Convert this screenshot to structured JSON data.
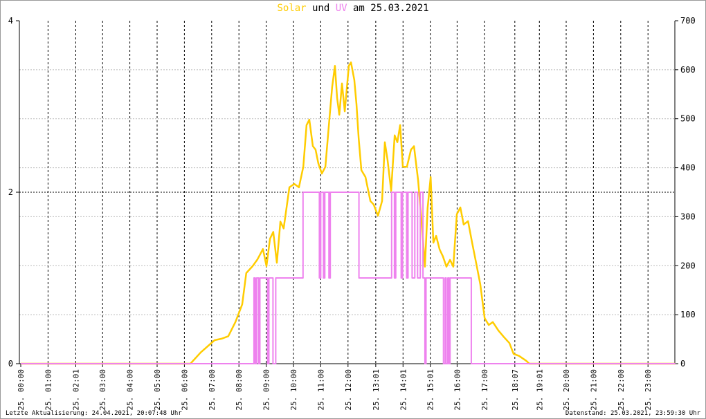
{
  "title": {
    "part1": "Solar",
    "part2": " und ",
    "part3": "UV",
    "part4": " am 25.03.2021"
  },
  "footer": {
    "left": "Letzte Aktualisierung: 24.04.2021, 20:07:48 Uhr",
    "right": "Datenstand: 25.03.2021, 23:59:30 Uhr"
  },
  "colors": {
    "solar": "#ffcc00",
    "uv": "#ee82ee",
    "grid": "#000000"
  },
  "chart_data": {
    "type": "line",
    "title": "Solar und UV am 25.03.2021",
    "xlim": [
      0,
      24
    ],
    "y_left": {
      "label": "UV",
      "ylim": [
        0,
        4
      ],
      "ticks": [
        0,
        2,
        4
      ]
    },
    "y_right": {
      "label": "Solar",
      "ylim": [
        0,
        700
      ],
      "ticks": [
        0,
        100,
        200,
        300,
        400,
        500,
        600,
        700
      ]
    },
    "x_ticks": [
      {
        "h": 0,
        "label": "25. 00:00"
      },
      {
        "h": 1,
        "label": "25. 01:00"
      },
      {
        "h": 2.017,
        "label": "25. 02:01"
      },
      {
        "h": 3,
        "label": "25. 03:00"
      },
      {
        "h": 4,
        "label": "25. 04:00"
      },
      {
        "h": 5,
        "label": "25. 05:00"
      },
      {
        "h": 6,
        "label": "25. 06:00"
      },
      {
        "h": 7,
        "label": "25. 07:00"
      },
      {
        "h": 8,
        "label": "25. 08:00"
      },
      {
        "h": 9,
        "label": "25. 09:00"
      },
      {
        "h": 10,
        "label": "25. 10:00"
      },
      {
        "h": 11,
        "label": "25. 11:00"
      },
      {
        "h": 12,
        "label": "25. 12:00"
      },
      {
        "h": 13.017,
        "label": "25. 13:01"
      },
      {
        "h": 14.017,
        "label": "25. 14:01"
      },
      {
        "h": 15.017,
        "label": "25. 15:01"
      },
      {
        "h": 16,
        "label": "25. 16:00"
      },
      {
        "h": 17,
        "label": "25. 17:00"
      },
      {
        "h": 18.117,
        "label": "25. 18:07"
      },
      {
        "h": 19.017,
        "label": "25. 19:01"
      },
      {
        "h": 20,
        "label": "25. 20:00"
      },
      {
        "h": 21,
        "label": "25. 21:00"
      },
      {
        "h": 22,
        "label": "25. 22:00"
      },
      {
        "h": 23,
        "label": "25. 23:00"
      }
    ],
    "series": [
      {
        "name": "Solar",
        "axis": "right",
        "points": [
          [
            0,
            0
          ],
          [
            6.22,
            0
          ],
          [
            6.6,
            23
          ],
          [
            7.11,
            48
          ],
          [
            7.36,
            51
          ],
          [
            7.61,
            56
          ],
          [
            7.87,
            85
          ],
          [
            8.12,
            121
          ],
          [
            8.27,
            185
          ],
          [
            8.5,
            199
          ],
          [
            8.68,
            213
          ],
          [
            8.88,
            234
          ],
          [
            9.01,
            199
          ],
          [
            9.14,
            255
          ],
          [
            9.26,
            269
          ],
          [
            9.39,
            206
          ],
          [
            9.52,
            290
          ],
          [
            9.64,
            276
          ],
          [
            9.85,
            360
          ],
          [
            10.03,
            367
          ],
          [
            10.2,
            360
          ],
          [
            10.36,
            402
          ],
          [
            10.48,
            487
          ],
          [
            10.58,
            498
          ],
          [
            10.71,
            444
          ],
          [
            10.81,
            437
          ],
          [
            10.91,
            409
          ],
          [
            11.04,
            388
          ],
          [
            11.17,
            402
          ],
          [
            11.32,
            501
          ],
          [
            11.42,
            565
          ],
          [
            11.52,
            608
          ],
          [
            11.6,
            543
          ],
          [
            11.68,
            508
          ],
          [
            11.78,
            572
          ],
          [
            11.88,
            515
          ],
          [
            12.03,
            608
          ],
          [
            12.11,
            615
          ],
          [
            12.23,
            579
          ],
          [
            12.31,
            530
          ],
          [
            12.39,
            460
          ],
          [
            12.49,
            395
          ],
          [
            12.64,
            381
          ],
          [
            12.82,
            332
          ],
          [
            12.94,
            325
          ],
          [
            13.1,
            302
          ],
          [
            13.25,
            332
          ],
          [
            13.35,
            452
          ],
          [
            13.45,
            416
          ],
          [
            13.58,
            353
          ],
          [
            13.71,
            466
          ],
          [
            13.81,
            452
          ],
          [
            13.91,
            487
          ],
          [
            14.01,
            402
          ],
          [
            14.16,
            402
          ],
          [
            14.31,
            437
          ],
          [
            14.42,
            444
          ],
          [
            14.57,
            374
          ],
          [
            14.72,
            275
          ],
          [
            14.82,
            198
          ],
          [
            14.92,
            318
          ],
          [
            15.03,
            381
          ],
          [
            15.13,
            247
          ],
          [
            15.23,
            261
          ],
          [
            15.36,
            233
          ],
          [
            15.48,
            219
          ],
          [
            15.61,
            198
          ],
          [
            15.74,
            212
          ],
          [
            15.86,
            198
          ],
          [
            15.99,
            305
          ],
          [
            16.12,
            319
          ],
          [
            16.24,
            284
          ],
          [
            16.4,
            291
          ],
          [
            16.55,
            247
          ],
          [
            16.7,
            205
          ],
          [
            16.85,
            162
          ],
          [
            17.01,
            93
          ],
          [
            17.16,
            79
          ],
          [
            17.31,
            85
          ],
          [
            17.51,
            68
          ],
          [
            17.72,
            54
          ],
          [
            17.92,
            42
          ],
          [
            18.07,
            20
          ],
          [
            18.27,
            16
          ],
          [
            18.53,
            6
          ],
          [
            18.65,
            0
          ],
          [
            24,
            0
          ]
        ]
      },
      {
        "name": "UV",
        "axis": "left",
        "step": true,
        "points": [
          [
            0,
            0
          ],
          [
            8.55,
            1
          ],
          [
            8.6,
            0
          ],
          [
            8.65,
            1
          ],
          [
            8.72,
            0
          ],
          [
            8.77,
            1
          ],
          [
            9.05,
            0
          ],
          [
            9.1,
            1
          ],
          [
            9.25,
            0
          ],
          [
            9.35,
            1
          ],
          [
            10.35,
            2
          ],
          [
            10.95,
            1
          ],
          [
            11.0,
            2
          ],
          [
            11.1,
            1
          ],
          [
            11.15,
            2
          ],
          [
            11.3,
            1
          ],
          [
            11.35,
            2
          ],
          [
            12.4,
            1
          ],
          [
            13.6,
            2
          ],
          [
            13.7,
            1
          ],
          [
            13.75,
            2
          ],
          [
            13.95,
            1
          ],
          [
            14.0,
            2
          ],
          [
            14.15,
            1
          ],
          [
            14.2,
            2
          ],
          [
            14.35,
            1
          ],
          [
            14.45,
            2
          ],
          [
            14.55,
            1
          ],
          [
            14.65,
            2
          ],
          [
            14.75,
            1
          ],
          [
            14.82,
            0
          ],
          [
            14.86,
            1
          ],
          [
            15.5,
            0
          ],
          [
            15.56,
            1
          ],
          [
            15.6,
            0
          ],
          [
            15.66,
            1
          ],
          [
            15.7,
            0
          ],
          [
            15.74,
            1
          ],
          [
            16.52,
            0
          ],
          [
            24,
            0
          ]
        ]
      }
    ]
  }
}
